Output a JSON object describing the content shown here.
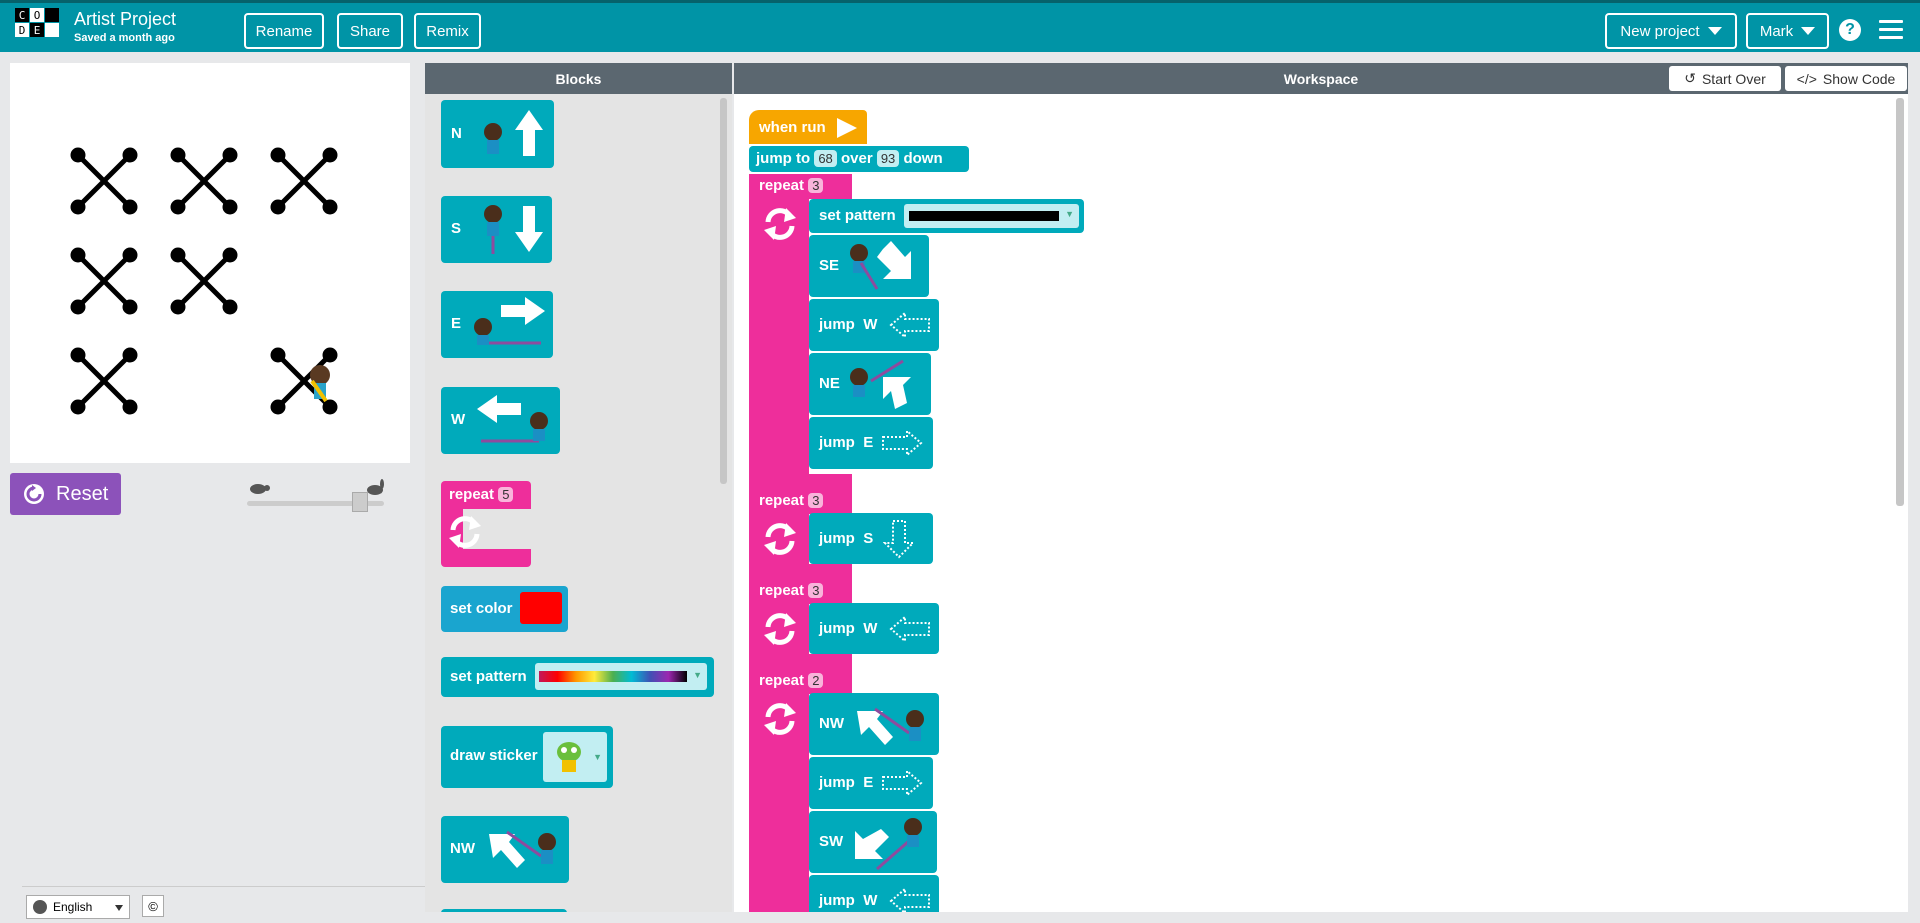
{
  "header": {
    "logo_letters": [
      "C",
      "O",
      "",
      "D",
      "E",
      ""
    ],
    "title": "Artist Project",
    "subtitle": "Saved a month ago",
    "buttons": {
      "rename": "Rename",
      "share": "Share",
      "remix": "Remix"
    },
    "new_project": "New project",
    "user": "Mark",
    "help": "?"
  },
  "left": {
    "reset_label": "Reset",
    "language": "English",
    "copyright": "©"
  },
  "toolbox": {
    "header": "Blocks",
    "blocks": {
      "n": "N",
      "s": "S",
      "e": "E",
      "w": "W",
      "repeat_label": "repeat",
      "repeat_count": "5",
      "set_color": "set color",
      "set_pattern": "set pattern",
      "draw_sticker": "draw sticker",
      "nw": "NW"
    }
  },
  "workspace": {
    "header": "Workspace",
    "start_over": "Start Over",
    "show_code": "Show Code",
    "when_run": "when run",
    "jump_to": {
      "prefix": "jump to",
      "x": "68",
      "over": "over",
      "y": "93",
      "down": "down"
    },
    "repeat_label": "repeat",
    "repeat_counts": [
      "3",
      "3",
      "3",
      "2"
    ],
    "set_pattern": "set pattern",
    "se": "SE",
    "jump": "jump",
    "dir_w": "W",
    "dir_e": "E",
    "dir_s": "S",
    "ne": "NE",
    "nw": "NW",
    "sw": "SW"
  },
  "colors": {
    "header": "#0094a6",
    "block_teal": "#00aabb",
    "block_pink": "#ee2e9b",
    "block_orange": "#f7a600",
    "reset_purple": "#8c52ba",
    "set_color_swatch": "#ff0000"
  }
}
